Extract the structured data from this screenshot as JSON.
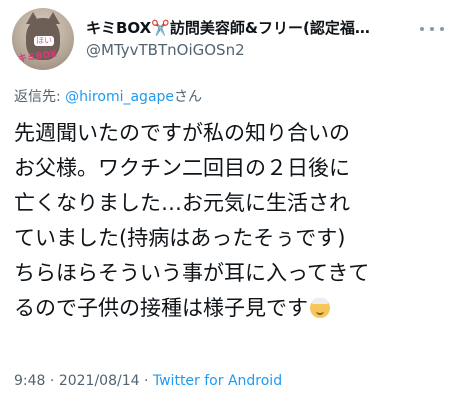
{
  "tweet": {
    "author": {
      "display_name": "キミBOX✂️訪問美容師&フリー(認定福…",
      "handle": "@MTyvTBTnOiGOSn2",
      "avatar_text_top": "ほい",
      "avatar_text_bottom": "キミBOX"
    },
    "reply": {
      "prefix": "返信先: ",
      "mention": "@hiromi_agape",
      "suffix": "さん"
    },
    "body_lines": [
      "先週聞いたのですが私の知り合いの",
      "お父様。ワクチン二回目の２日後に",
      "亡くなりました…お元気に生活され",
      "ていました(持病はあったそぅです)",
      "ちらほらそういう事が耳に入ってきて",
      "るので子供の接種は様子見です"
    ],
    "body_emoji": "older-man-emoji",
    "meta": {
      "time": "9:48",
      "sep1": " · ",
      "date": "2021/08/14",
      "sep2": " · ",
      "source": "Twitter for Android"
    },
    "icons": {
      "more": "more-horizontal-icon"
    },
    "colors": {
      "link": "#1d9bf0",
      "secondary": "#536471",
      "text": "#0f1419"
    }
  }
}
